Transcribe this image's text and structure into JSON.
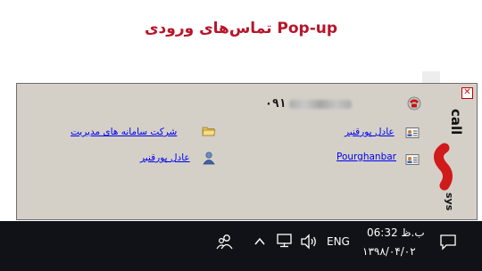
{
  "page": {
    "title": "Pop-up تماس‌های ورودی"
  },
  "popup": {
    "close_glyph": "✕",
    "phone_prefix": "۰۹۱",
    "contacts": [
      {
        "label": "عادل پورقنبر",
        "icon": "contact-card-icon"
      },
      {
        "label": "Pourghanbar",
        "icon": "contact-card-icon"
      }
    ],
    "details": [
      {
        "label": "شرکت سامانه های مدیریت",
        "icon": "folder-icon"
      },
      {
        "label": "عادل پورقنبر",
        "icon": "user-icon"
      }
    ],
    "logo_text": "SYS CALL"
  },
  "taskbar": {
    "language": "ENG",
    "time": "ب.ظ 06:32",
    "date": "۱۳۹۸/۰۴/۰۲",
    "icons": [
      "people-icon",
      "chevron-up-icon",
      "network-icon",
      "volume-icon",
      "notification-icon"
    ]
  },
  "colors": {
    "title": "#b8142a",
    "popup_bg": "#d4d0c8",
    "taskbar_bg": "#101217",
    "link": "#0000ee",
    "logo_red": "#d11a1a"
  }
}
